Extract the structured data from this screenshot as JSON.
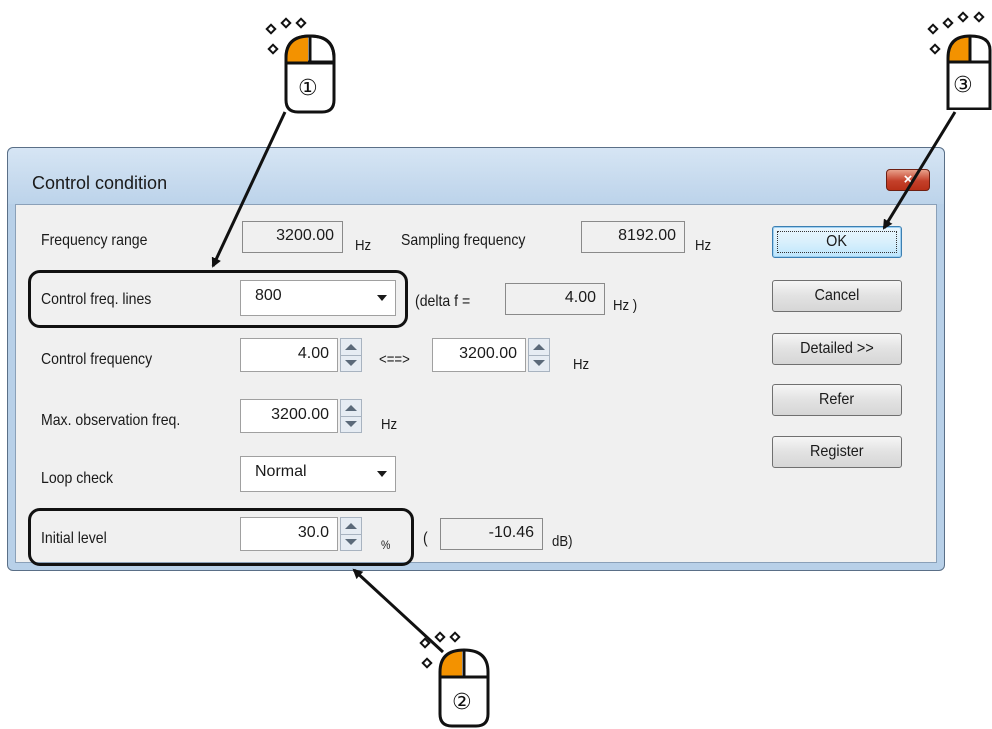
{
  "dialog": {
    "title": "Control condition",
    "close_glyph": "×"
  },
  "fields": {
    "frequency_range": {
      "label": "Frequency range",
      "value": "3200.00",
      "unit": "Hz"
    },
    "sampling_frequency": {
      "label": "Sampling frequency",
      "value": "8192.00",
      "unit": "Hz"
    },
    "control_freq_lines": {
      "label": "Control freq. lines",
      "selected": "800"
    },
    "delta_f": {
      "prefix": "(delta f =",
      "value": "4.00",
      "unit": "Hz )"
    },
    "control_frequency": {
      "label": "Control frequency",
      "low": "4.00",
      "separator": "<==>",
      "high": "3200.00",
      "unit": "Hz"
    },
    "max_observation_freq": {
      "label": "Max. observation freq.",
      "value": "3200.00",
      "unit": "Hz"
    },
    "loop_check": {
      "label": "Loop check",
      "selected": "Normal"
    },
    "initial_level": {
      "label": "Initial level",
      "value": "30.0",
      "unit": "%",
      "open_paren": "(",
      "db_value": "-10.46",
      "db_unit": "dB)"
    }
  },
  "buttons": {
    "ok": "OK",
    "cancel": "Cancel",
    "detailed": "Detailed >>",
    "refer": "Refer",
    "register": "Register"
  },
  "callouts": {
    "one": "①",
    "two": "②",
    "three": "③"
  },
  "colors": {
    "mouse_button": "#f39200",
    "dialog_frame": "#b8d0e8",
    "client_bg": "#f0f0f0",
    "close_button": "#c4402a"
  },
  "icons": [
    "mouse-icon",
    "close-icon",
    "spin-up-icon",
    "spin-down-icon",
    "dropdown-arrow-icon"
  ]
}
